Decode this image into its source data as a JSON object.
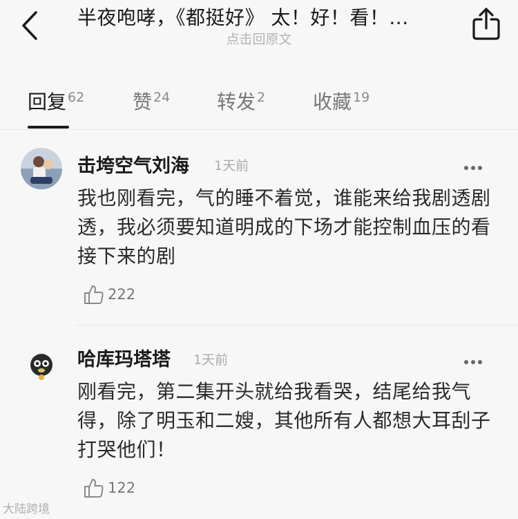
{
  "header": {
    "title": "半夜咆哮，《都挺好》 太！好！看！...",
    "subtitle": "点击回原文",
    "back_icon": "back-chevron-icon",
    "share_icon": "share-icon"
  },
  "tabs": [
    {
      "label": "回复",
      "count": "62",
      "active": true
    },
    {
      "label": "赞",
      "count": "24",
      "active": false
    },
    {
      "label": "转发",
      "count": "2",
      "active": false
    },
    {
      "label": "收藏",
      "count": "19",
      "active": false
    }
  ],
  "comments": [
    {
      "username": "击垮空气刘海",
      "time": "1天前",
      "text": "我也刚看完，气的睡不着觉，谁能来给我剧透剧透，我必须要知道明成的下场才能控制血压的看接下来的剧",
      "likes": "222"
    },
    {
      "username": "哈库玛塔塔",
      "time": "1天前",
      "text": "刚看完，第二集开头就给我看哭，结尾给我气得，除了明玉和二嫂，其他所有人都想大耳刮子打哭他们！",
      "likes": "122"
    }
  ],
  "watermark": "大陆跨境",
  "colors": {
    "background": "#f7f7f7",
    "text_primary": "#1a1a1a",
    "text_secondary": "#aaaaaa"
  }
}
